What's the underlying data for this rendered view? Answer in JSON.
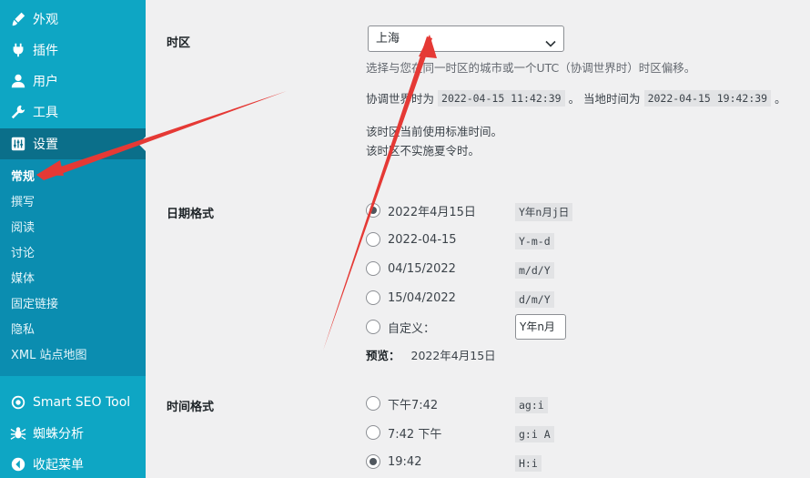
{
  "sidebar": {
    "top_items": [
      {
        "label": "外观",
        "icon": "paintbrush-icon"
      },
      {
        "label": "插件",
        "icon": "plugin-icon"
      },
      {
        "label": "用户",
        "icon": "user-icon"
      },
      {
        "label": "工具",
        "icon": "wrench-icon"
      },
      {
        "label": "设置",
        "icon": "settings-icon"
      }
    ],
    "sub_items": [
      "常规",
      "撰写",
      "阅读",
      "讨论",
      "媒体",
      "固定链接",
      "隐私",
      "XML 站点地图"
    ],
    "bottom_items": [
      {
        "label": "Smart SEO Tool",
        "icon": "seo-icon"
      },
      {
        "label": "蜘蛛分析",
        "icon": "spider-icon"
      },
      {
        "label": "收起菜单",
        "icon": "collapse-icon"
      }
    ]
  },
  "timezone": {
    "label": "时区",
    "selected": "上海",
    "help": "选择与您在同一时区的城市或一个UTC（协调世界时）时区偏移。",
    "utc_prefix": "协调世界时为",
    "utc_time": "2022-04-15 11:42:39",
    "local_prefix": "。 当地时间为",
    "local_time": "2022-04-15 19:42:39",
    "suffix": "。",
    "note1": "该时区当前使用标准时间。",
    "note2": "该时区不实施夏令时。"
  },
  "date_format": {
    "label": "日期格式",
    "options": [
      {
        "label": "2022年4月15日",
        "code": "Y年n月j日",
        "checked": true
      },
      {
        "label": "2022-04-15",
        "code": "Y-m-d",
        "checked": false
      },
      {
        "label": "04/15/2022",
        "code": "m/d/Y",
        "checked": false
      },
      {
        "label": "15/04/2022",
        "code": "d/m/Y",
        "checked": false
      }
    ],
    "custom_label": "自定义：",
    "custom_value": "Y年n月",
    "preview_label": "预览：",
    "preview_value": "2022年4月15日"
  },
  "time_format": {
    "label": "时间格式",
    "options": [
      {
        "label": "下午7:42",
        "code": "ag:i",
        "checked": false
      },
      {
        "label": "7:42 下午",
        "code": "g:i A",
        "checked": false
      },
      {
        "label": "19:42",
        "code": "H:i",
        "checked": true
      }
    ]
  },
  "colors": {
    "sidebar_bg": "#0ea6c4",
    "submenu_bg": "#0b8db0",
    "current_bg": "#0b6f8a",
    "arrow": "#e53935"
  }
}
